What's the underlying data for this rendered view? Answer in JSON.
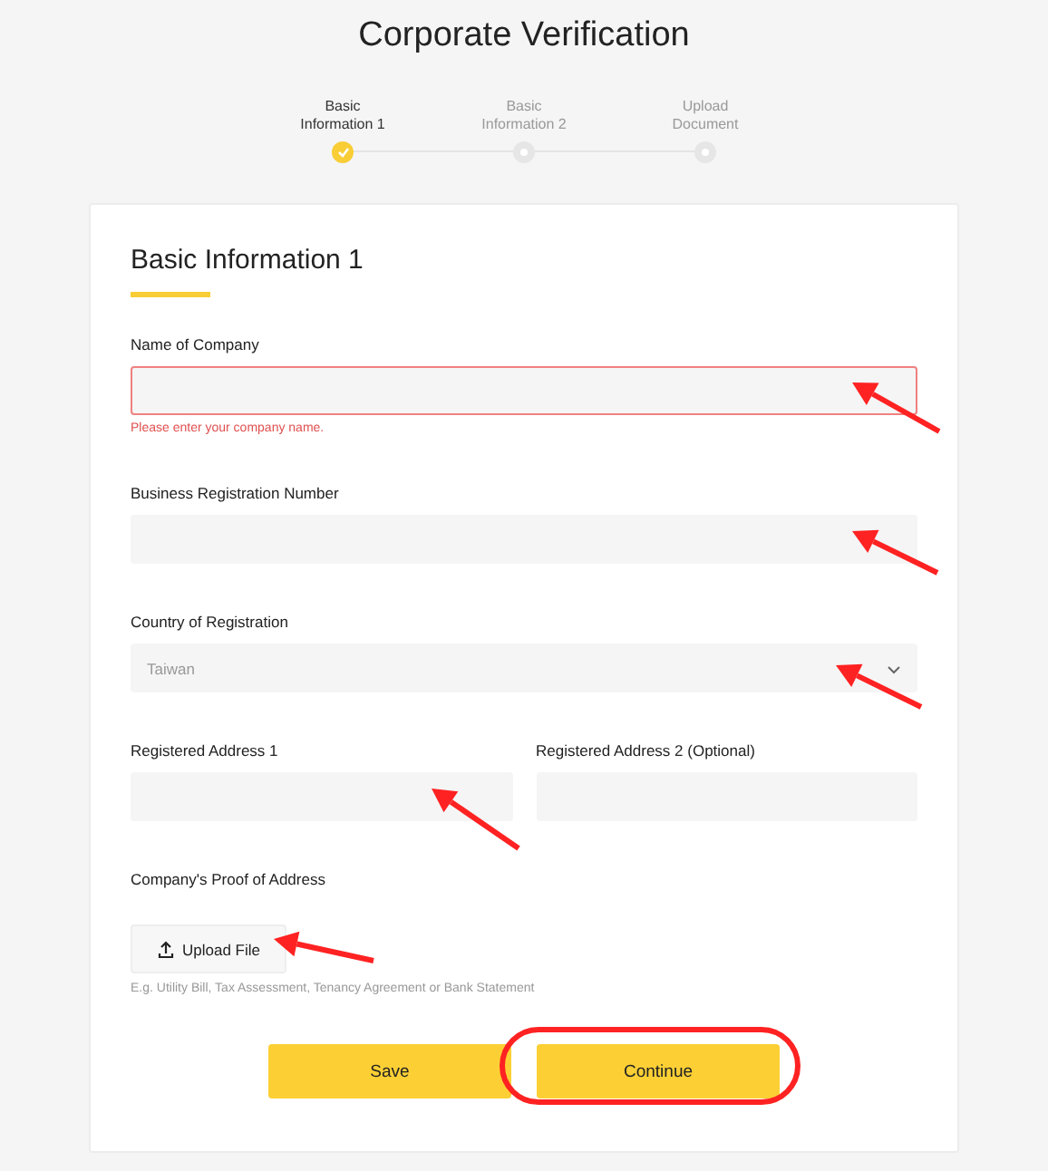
{
  "title": "Corporate Verification",
  "steps": [
    {
      "label": "Basic\nInformation 1",
      "done": true
    },
    {
      "label": "Basic\nInformation 2",
      "done": false
    },
    {
      "label": "Upload\nDocument",
      "done": false
    }
  ],
  "form": {
    "heading": "Basic Information 1",
    "rows": [
      [
        {
          "kind": "text",
          "label": "Name of Company",
          "invalid": true,
          "error": "Please enter your company name."
        }
      ],
      [
        {
          "kind": "text",
          "label": "Business Registration Number",
          "invalid": false
        }
      ],
      [
        {
          "kind": "select",
          "label": "Country of Registration",
          "value": "Taiwan",
          "invalid": false
        }
      ],
      [
        {
          "kind": "text",
          "label": "Registered Address 1",
          "invalid": false
        },
        {
          "kind": "text",
          "label": "Registered Address 2 (Optional)",
          "invalid": false
        }
      ],
      [
        {
          "kind": "upload",
          "label": "Company's Proof of Address",
          "button": "Upload File",
          "hint": "E.g. Utility Bill, Tax Assessment, Tenancy Agreement or Bank Statement"
        }
      ]
    ],
    "buttons": [
      "Save",
      "Continue"
    ]
  }
}
